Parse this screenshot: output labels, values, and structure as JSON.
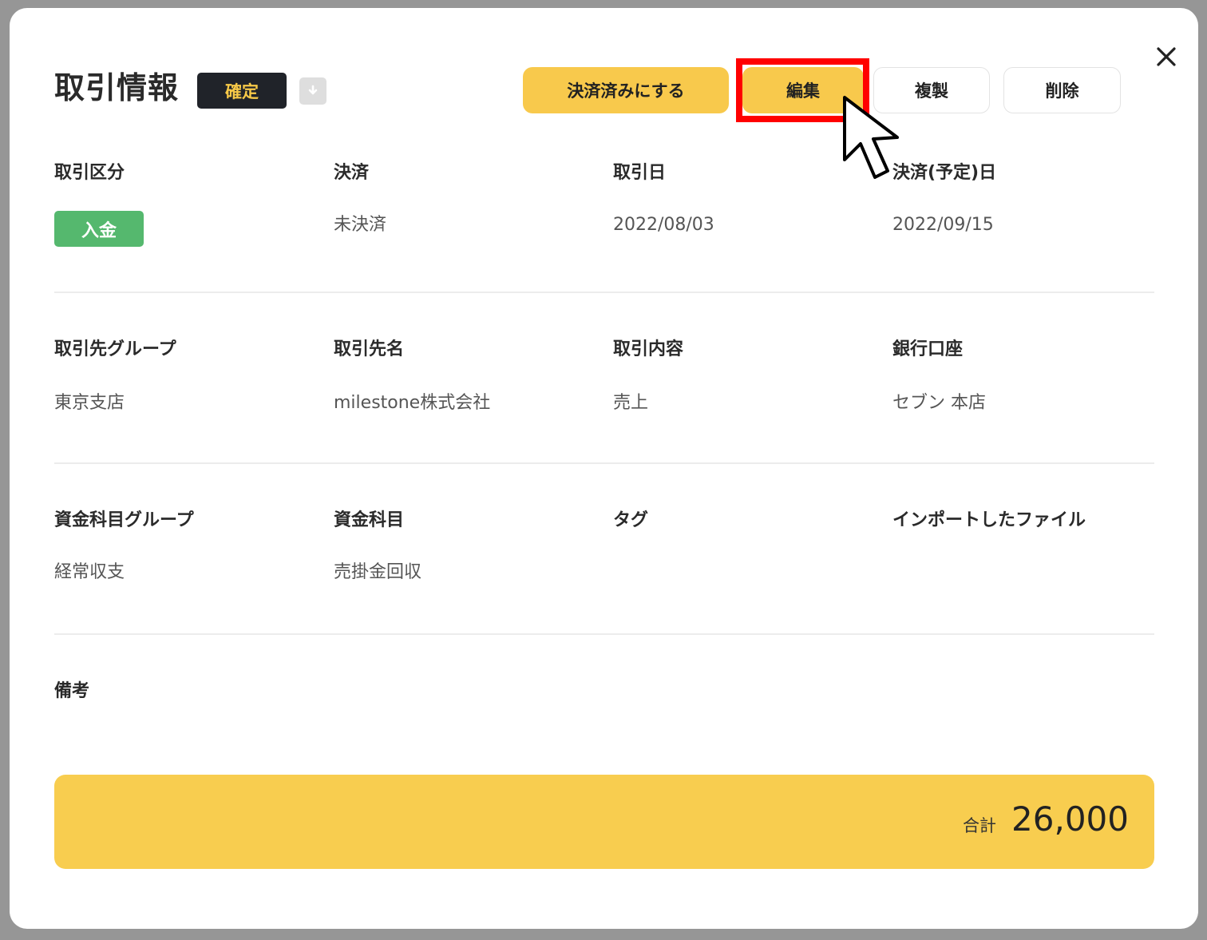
{
  "modal": {
    "title": "取引情報",
    "status_badge": "確定",
    "icons": {
      "close": "close-icon",
      "archive": "archive-download-icon",
      "cursor": "mouse-pointer-icon"
    }
  },
  "actions": {
    "settle_label": "決済済みにする",
    "edit_label": "編集",
    "duplicate_label": "複製",
    "delete_label": "削除"
  },
  "fields": {
    "row1": {
      "type_label": "取引区分",
      "type_value": "入金",
      "settlement_label": "決済",
      "settlement_value": "未決済",
      "date_label": "取引日",
      "date_value": "2022/08/03",
      "due_label": "決済(予定)日",
      "due_value": "2022/09/15"
    },
    "row2": {
      "group_label": "取引先グループ",
      "group_value": "東京支店",
      "partner_label": "取引先名",
      "partner_value": "milestone株式会社",
      "content_label": "取引内容",
      "content_value": "売上",
      "bank_label": "銀行口座",
      "bank_value": "セブン 本店"
    },
    "row3": {
      "fund_group_label": "資金科目グループ",
      "fund_group_value": "経常収支",
      "fund_label": "資金科目",
      "fund_value": "売掛金回収",
      "tag_label": "タグ",
      "tag_value": "",
      "import_label": "インポートしたファイル",
      "import_value": ""
    },
    "notes_label": "備考",
    "notes_value": ""
  },
  "total": {
    "label": "合計",
    "value": "26,000"
  },
  "colors": {
    "accent_yellow": "#f8c94c",
    "badge_dark": "#202329",
    "income_green": "#55b86e",
    "highlight_red": "#ff0000"
  }
}
